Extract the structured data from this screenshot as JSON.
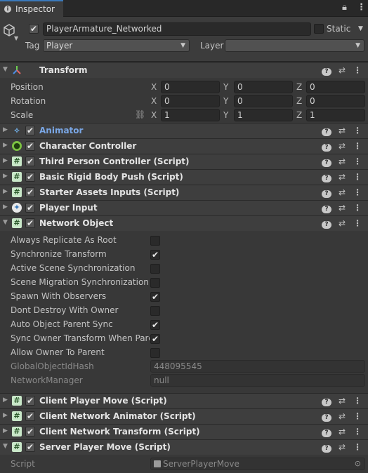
{
  "tab": {
    "label": "Inspector",
    "icon": "info-icon"
  },
  "header": {
    "object_name": "PlayerArmature_Networked",
    "active": true,
    "static_label": "Static",
    "tag_label": "Tag",
    "tag_value": "Player",
    "layer_label": "Layer",
    "layer_value": ""
  },
  "transform": {
    "title": "Transform",
    "position": {
      "label": "Position",
      "x": "0",
      "y": "0",
      "z": "0"
    },
    "rotation": {
      "label": "Rotation",
      "x": "0",
      "y": "0",
      "z": "0"
    },
    "scale": {
      "label": "Scale",
      "x": "1",
      "y": "1",
      "z": "1"
    },
    "axis": {
      "x": "X",
      "y": "Y",
      "z": "Z"
    }
  },
  "components": {
    "animator": "Animator",
    "character_controller": "Character Controller",
    "third_person": "Third Person Controller (Script)",
    "rigid_push": "Basic Rigid Body Push (Script)",
    "starter_inputs": "Starter Assets Inputs (Script)",
    "player_input": "Player Input",
    "network_object": "Network Object",
    "client_move": "Client Player Move (Script)",
    "client_animator": "Client Network Animator (Script)",
    "client_transform": "Client Network Transform (Script)",
    "server_move": "Server Player Move (Script)"
  },
  "network_object": {
    "props": [
      {
        "label": "Always Replicate As Root",
        "checked": false
      },
      {
        "label": "Synchronize Transform",
        "checked": true
      },
      {
        "label": "Active Scene Synchronization",
        "checked": false
      },
      {
        "label": "Scene Migration Synchronization",
        "checked": false
      },
      {
        "label": "Spawn With Observers",
        "checked": true
      },
      {
        "label": "Dont Destroy With Owner",
        "checked": false
      },
      {
        "label": "Auto Object Parent Sync",
        "checked": true
      },
      {
        "label": "Sync Owner Transform When Parent",
        "checked": true
      },
      {
        "label": "Allow Owner To Parent",
        "checked": false
      }
    ],
    "hash_label": "GlobalObjectIdHash",
    "hash_value": "448095545",
    "manager_label": "NetworkManager",
    "manager_value": "null"
  },
  "server_move": {
    "script_label": "Script",
    "script_value": "ServerPlayerMove"
  },
  "checkmark": "✔",
  "colors": {
    "accent": "#3a79bb",
    "background": "#383838",
    "header": "#3e3e3e",
    "animator_title": "#7aa7e6"
  }
}
